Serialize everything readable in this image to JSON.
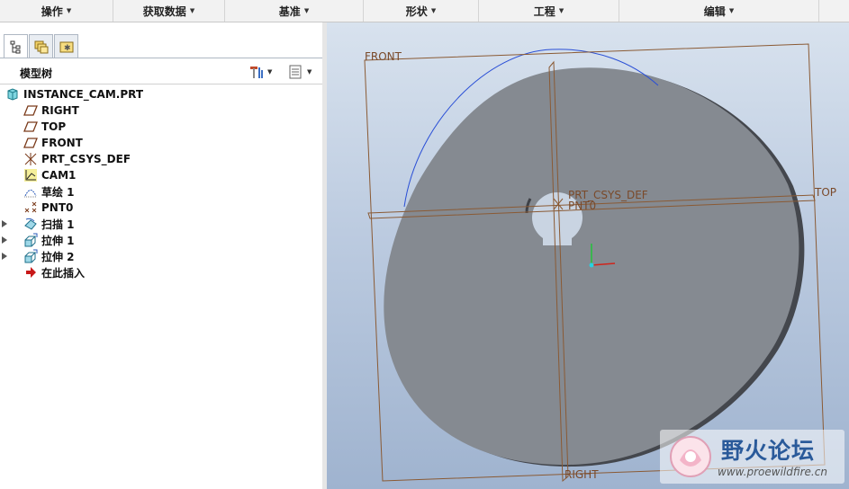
{
  "menubar": {
    "items": [
      {
        "label": "操作"
      },
      {
        "label": "获取数据"
      },
      {
        "label": "基准"
      },
      {
        "label": "形状"
      },
      {
        "label": "工程"
      },
      {
        "label": "编辑"
      }
    ]
  },
  "panel": {
    "tabs": [
      {
        "icon": "model-tree-icon"
      },
      {
        "icon": "folder-browser-icon"
      },
      {
        "icon": "favorites-icon"
      }
    ],
    "tree_title": "模型树",
    "header_buttons": [
      {
        "icon": "tree-settings-icon"
      },
      {
        "icon": "tree-filter-icon"
      }
    ],
    "tree": [
      {
        "label": "INSTANCE_CAM.PRT",
        "icon": "part-icon",
        "expandable": false
      },
      {
        "label": "RIGHT",
        "icon": "datum-plane-icon",
        "expandable": false
      },
      {
        "label": "TOP",
        "icon": "datum-plane-icon",
        "expandable": false
      },
      {
        "label": "FRONT",
        "icon": "datum-plane-icon",
        "expandable": false
      },
      {
        "label": "PRT_CSYS_DEF",
        "icon": "coordinate-system-icon",
        "expandable": false
      },
      {
        "label": "CAM1",
        "icon": "cam-icon",
        "expandable": false
      },
      {
        "label": "草绘 1",
        "icon": "sketch-icon",
        "expandable": false
      },
      {
        "label": "PNT0",
        "icon": "datum-point-icon",
        "expandable": false
      },
      {
        "label": "扫描 1",
        "icon": "sweep-icon",
        "expandable": true
      },
      {
        "label": "拉伸 1",
        "icon": "extrude-icon",
        "expandable": true
      },
      {
        "label": "拉伸 2",
        "icon": "extrude-icon",
        "expandable": true
      },
      {
        "label": "在此插入",
        "icon": "insert-here-arrow-icon",
        "expandable": false
      }
    ]
  },
  "viewport": {
    "datum_labels": {
      "front": "FRONT",
      "top": "TOP",
      "right": "RIGHT",
      "csys": "PRT_CSYS_DEF",
      "point": "PNT0"
    },
    "colors": {
      "datum": "#8a5a34",
      "part": "#858a91",
      "part_edge": "#4c5058",
      "sketch_curve": "#2a4fd6",
      "background_top": "#d8e2ee",
      "background_bottom": "#9fb3cf"
    }
  },
  "watermark": {
    "title": "野火论坛",
    "url": "www.proewildfire.cn"
  }
}
